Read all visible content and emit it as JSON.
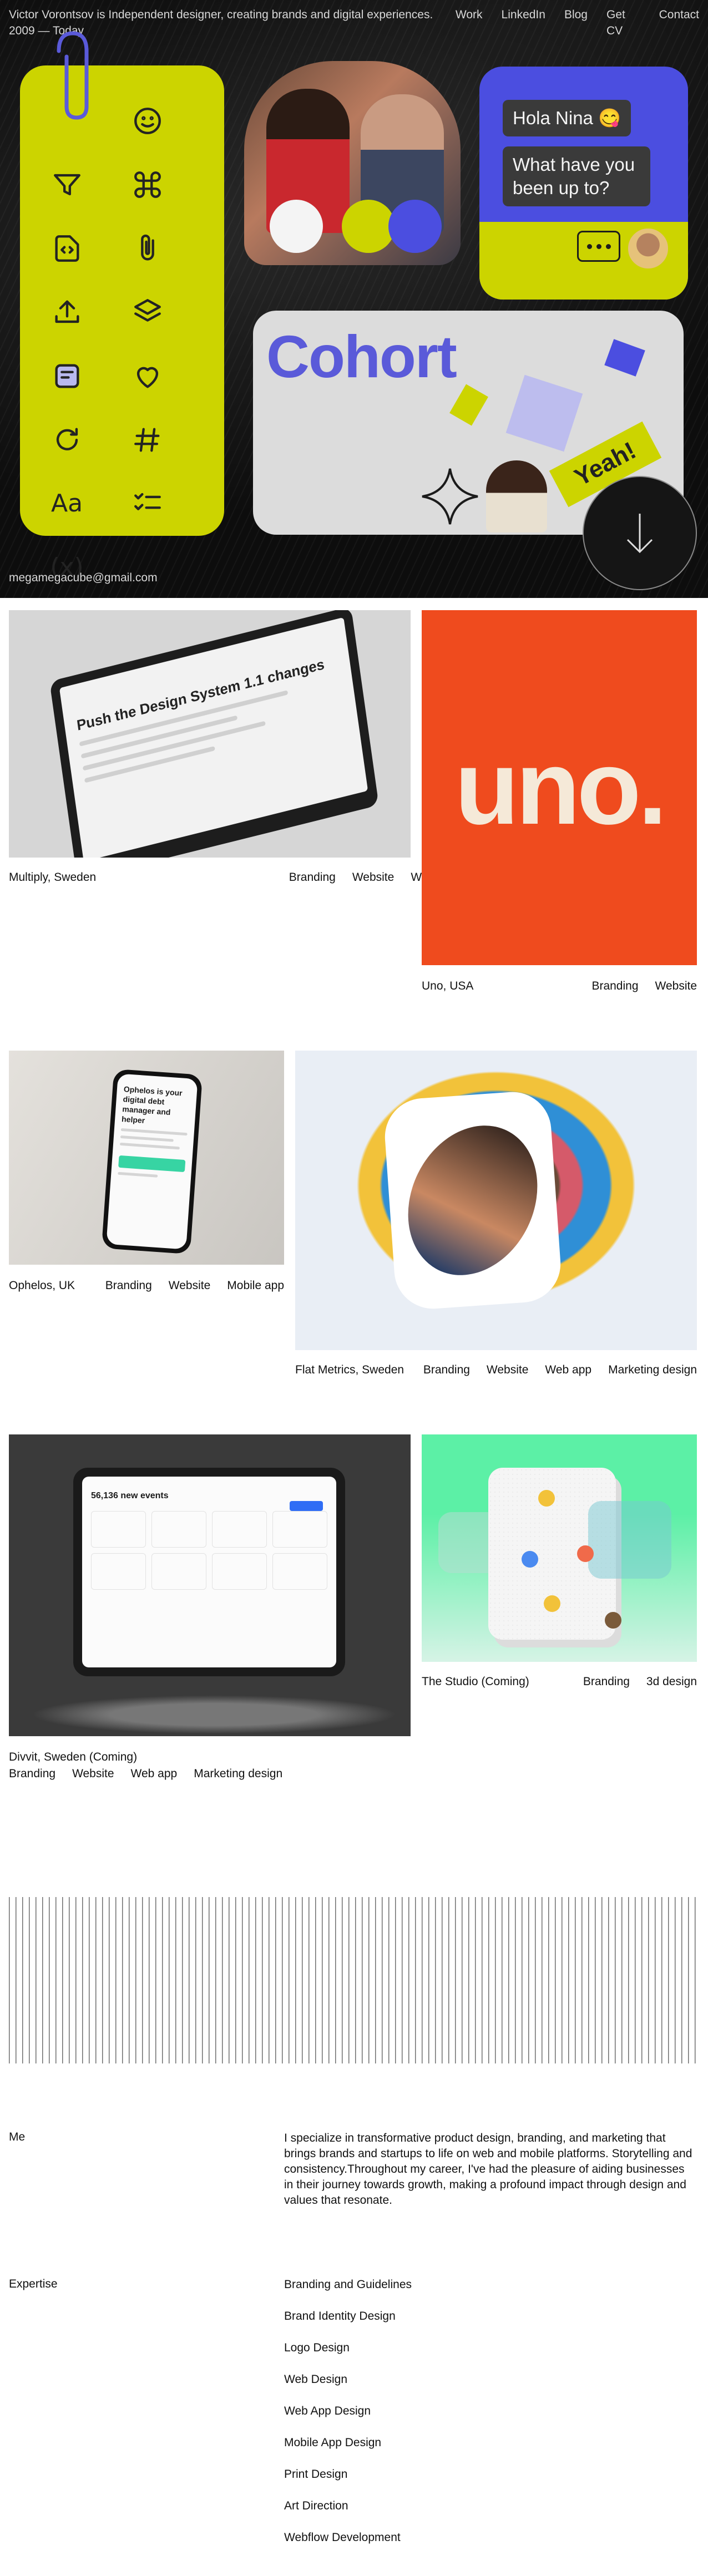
{
  "hero": {
    "intro": "Victor Vorontsov is Independent designer, creating brands and digital experiences. 2009 — Today",
    "nav": [
      "Work",
      "LinkedIn",
      "Blog",
      "Get CV",
      "Contact"
    ],
    "email": "megamegacube@gmail.com",
    "chat_greeting": "Hola Nina 😋",
    "chat_question": "What have you been up to?",
    "cohort_word": "Cohort",
    "yeah_word": "Yeah!",
    "icon_labels": {
      "type": "Aa",
      "variable": "(x)"
    },
    "colors": {
      "accent_lime": "#ccd400",
      "accent_blue": "#4b4ee0",
      "hero_bg": "#0d0d0d"
    }
  },
  "projects": [
    {
      "name": "Multiply, Sweden",
      "tags": [
        "Branding",
        "Website",
        "Web app"
      ],
      "screen_title": "Push the Design System 1.1 changes"
    },
    {
      "name": "Uno, USA",
      "tags": [
        "Branding",
        "Website"
      ],
      "wordmark": "uno."
    },
    {
      "name": "Ophelos, UK",
      "tags": [
        "Branding",
        "Website",
        "Mobile app"
      ],
      "screen_title": "Ophelos is your digital debt manager and helper"
    },
    {
      "name": "Flat Metrics, Sweden",
      "tags": [
        "Branding",
        "Website",
        "Web app",
        "Marketing design"
      ]
    },
    {
      "name": "Divvit, Sweden (Coming)",
      "tags": [
        "Branding",
        "Website",
        "Web app",
        "Marketing design"
      ],
      "screen_title": "56,136 new events"
    },
    {
      "name": "The Studio (Coming)",
      "tags": [
        "Branding",
        "3d design"
      ]
    }
  ],
  "about": {
    "me_label": "Me",
    "me_text": "I specialize in transformative product design, branding, and marketing that brings brands and startups to life on web and mobile platforms. Storytelling and consistency.Throughout my career, I've had the pleasure of aiding businesses in their journey towards growth, making a profound impact through design and values that resonate.",
    "expertise_label": "Expertise",
    "expertise": [
      "Branding and Guidelines",
      "Brand Identity Design",
      "Logo Design",
      "Web Design",
      "Web App Design",
      "Mobile App Design",
      "Print Design",
      "Art Direction",
      "Webflow Development"
    ]
  }
}
